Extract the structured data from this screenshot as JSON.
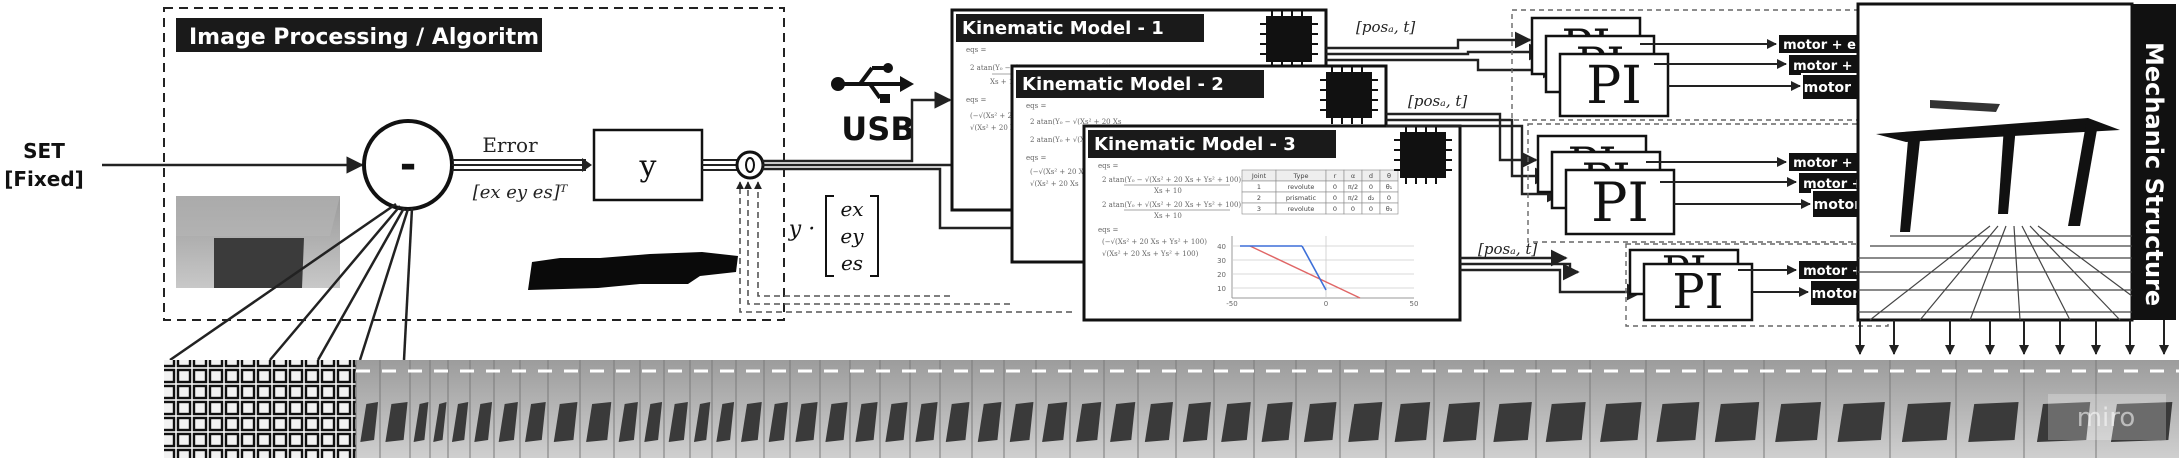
{
  "input": {
    "label_line1": "SET",
    "label_line2": "[Fixed]"
  },
  "processing": {
    "title": "Image Processing / Algoritm",
    "summing_symbol": "-",
    "error_label": "Error",
    "error_vector": "[ex  ey  es]ᵀ",
    "gain_label": "y"
  },
  "usb": {
    "label": "USB"
  },
  "scaled_error": {
    "gain": "y ·",
    "components": [
      "ex",
      "ey",
      "es"
    ]
  },
  "kinematic_models": [
    {
      "title": "Kinematic Model - 1"
    },
    {
      "title": "Kinematic Model - 2"
    },
    {
      "title": "Kinematic Model - 3"
    }
  ],
  "model3_content": {
    "dh_table": {
      "headers": [
        "Joint",
        "Type",
        "r",
        "α",
        "d",
        "θ"
      ],
      "rows": [
        [
          "1",
          "revolute",
          "0",
          "π/2",
          "0",
          "θ₁"
        ],
        [
          "2",
          "prismatic",
          "0",
          "π/2",
          "d₂",
          "0"
        ],
        [
          "3",
          "revolute",
          "0",
          "0",
          "0",
          "θ₃"
        ]
      ]
    },
    "plot_ticks_y": [
      "40",
      "30",
      "20",
      "10",
      "0"
    ],
    "plot_ticks_x": [
      "-50",
      "0",
      "50"
    ]
  },
  "links": {
    "pos_label": "[posₐ, t]"
  },
  "controllers": {
    "pi_label": "PI",
    "motor_label": "motor + enc"
  },
  "mechanic": {
    "title": "Mechanic Structure"
  },
  "watermark": "miro"
}
